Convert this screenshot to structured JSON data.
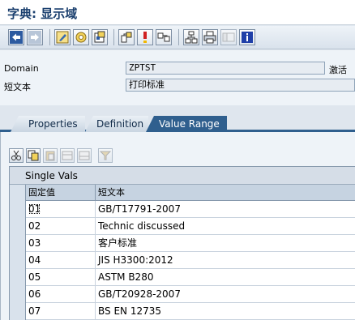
{
  "window": {
    "title": "字典: 显示域"
  },
  "toolbar": {
    "buttons": [
      {
        "icon": "back-arrow-icon"
      },
      {
        "icon": "forward-arrow-icon"
      },
      {
        "icon": "display-change-icon"
      },
      {
        "icon": "other-object-icon"
      },
      {
        "icon": "check-icon"
      },
      {
        "icon": "where-used-icon"
      },
      {
        "icon": "activate-icon"
      },
      {
        "icon": "navigate-icon"
      },
      {
        "icon": "hierarchy-icon"
      },
      {
        "icon": "print-icon"
      },
      {
        "icon": "display-object-list-icon"
      },
      {
        "icon": "info-icon"
      }
    ]
  },
  "attributes": {
    "domain_label": "Domain",
    "domain_value": "ZPTST",
    "status": "激活",
    "short_text_label": "短文本",
    "short_text_value": "打印标准"
  },
  "tabs": [
    {
      "label": "Properties",
      "active": false
    },
    {
      "label": "Definition",
      "active": false
    },
    {
      "label": "Value Range",
      "active": true
    }
  ],
  "table_toolbar": {
    "buttons": [
      {
        "icon": "cut-icon",
        "enabled": true
      },
      {
        "icon": "copy-icon",
        "enabled": true
      },
      {
        "icon": "paste-icon",
        "enabled": false
      },
      {
        "icon": "insert-row-icon",
        "enabled": false
      },
      {
        "icon": "delete-row-icon",
        "enabled": false
      },
      {
        "icon": "filter-icon",
        "enabled": false
      }
    ]
  },
  "single_vals": {
    "title": "Single Vals",
    "columns": [
      "固定值",
      "短文本"
    ],
    "rows": [
      {
        "value": "01",
        "text": "GB/T17791-2007"
      },
      {
        "value": "02",
        "text": "Technic discussed"
      },
      {
        "value": "03",
        "text": "客户标准"
      },
      {
        "value": "04",
        "text": "JIS H3300:2012"
      },
      {
        "value": "05",
        "text": "ASTM B280"
      },
      {
        "value": "06",
        "text": "GB/T20928-2007"
      },
      {
        "value": "07",
        "text": "BS EN 12735"
      }
    ]
  },
  "colors": {
    "title": "#1a3f6e",
    "active_tab": "#2f5f8e",
    "background": "#dfe6ee"
  }
}
